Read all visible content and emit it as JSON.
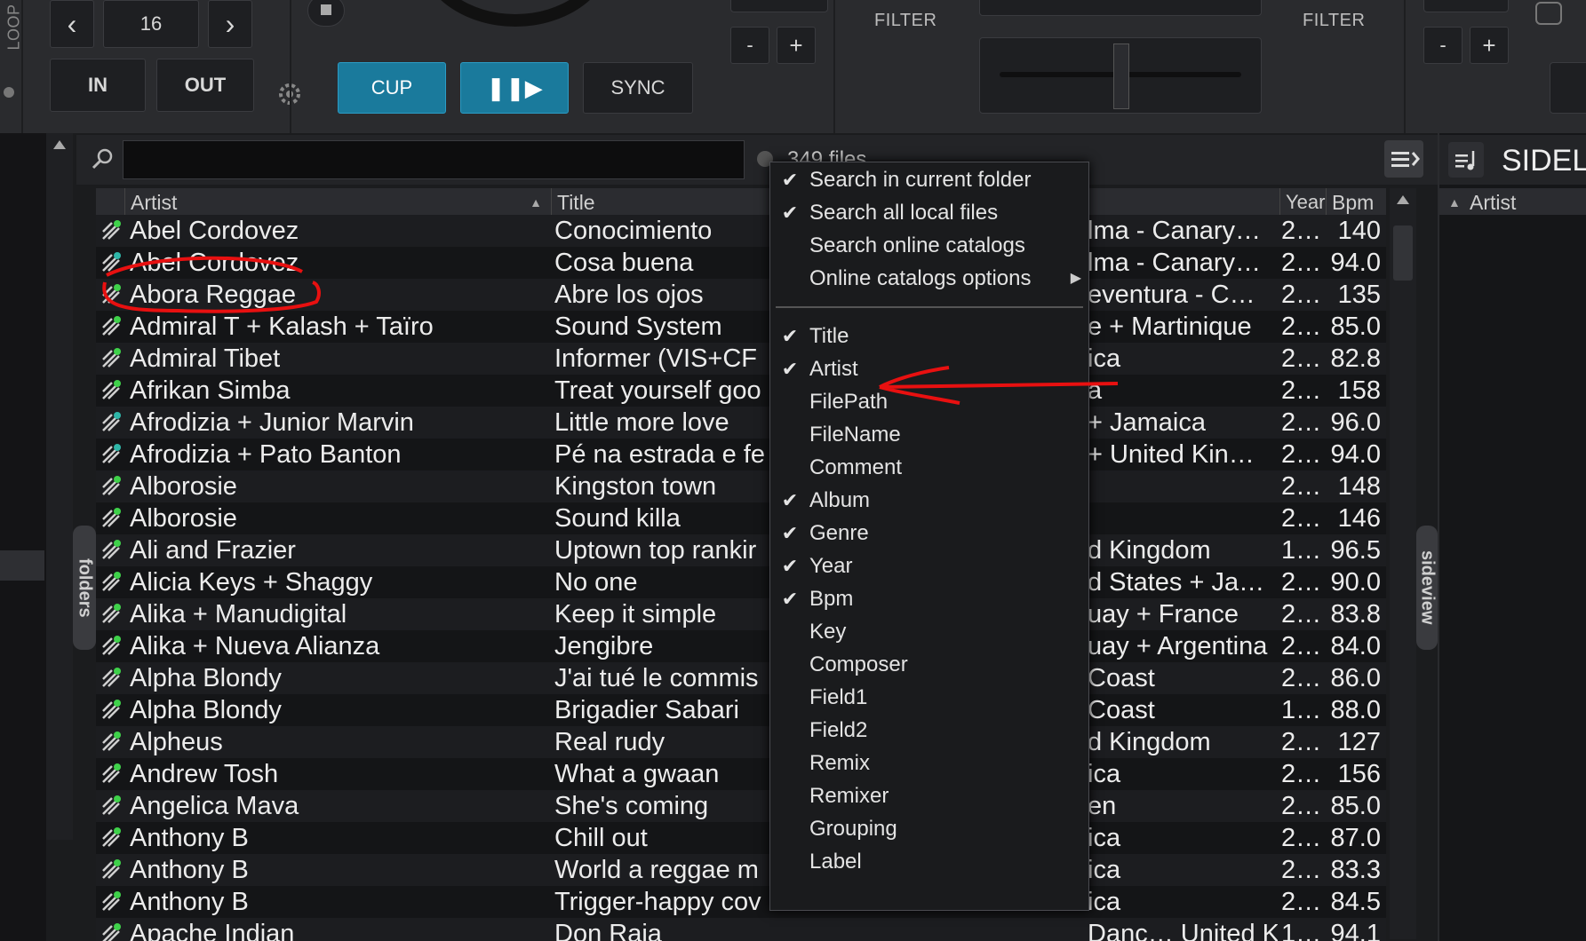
{
  "deck": {
    "loop_label": "LOOP",
    "loop_value": "16",
    "prev_label": "‹",
    "next_label": "›",
    "in_label": "IN",
    "out_label": "OUT",
    "cup_label": "CUP",
    "play_pause_label": "❚❚▶",
    "sync_label": "SYNC",
    "filter_left_label": "FILTER",
    "filter_right_label": "FILTER",
    "minus_label": "-",
    "plus_label": "+"
  },
  "browser": {
    "file_count": "349 files",
    "search_placeholder": "",
    "folders_tab": "folders",
    "sideview_tab": "sideview",
    "side_title": "SIDEL",
    "side_column": "Artist",
    "columns": [
      {
        "label": "Artist"
      },
      {
        "label": "Title"
      },
      {
        "label": "Year"
      },
      {
        "label": "Bpm"
      }
    ],
    "rows": [
      {
        "artist": "Abel Cordovez",
        "title": "Conocimiento",
        "extra": "lma - Canary…",
        "year": "2…",
        "bpm": "140",
        "icon": "green"
      },
      {
        "artist": "Abel Cordovez",
        "title": "Cosa buena",
        "extra": "lma - Canary…",
        "year": "2…",
        "bpm": "94.0",
        "icon": "teal"
      },
      {
        "artist": "Abora Reggae",
        "title": "Abre los ojos",
        "extra": "eventura - C…",
        "year": "2…",
        "bpm": "135",
        "icon": "green"
      },
      {
        "artist": "Admiral T + Kalash + Taïro",
        "title": "Sound System",
        "extra": "e + Martinique",
        "year": "2…",
        "bpm": "85.0",
        "icon": "green"
      },
      {
        "artist": "Admiral Tibet",
        "title": "Informer (VIS+CF",
        "extra": "ica",
        "year": "2…",
        "bpm": "82.8",
        "icon": "green"
      },
      {
        "artist": "Afrikan Simba",
        "title": "Treat yourself goo",
        "extra": "a",
        "year": "2…",
        "bpm": "158",
        "icon": "green"
      },
      {
        "artist": "Afrodizia + Junior Marvin",
        "title": "Little more love",
        "extra": "+ Jamaica",
        "year": "2…",
        "bpm": "96.0",
        "icon": "teal"
      },
      {
        "artist": "Afrodizia + Pato Banton",
        "title": "Pé na estrada e fe",
        "extra": "+ United Kin…",
        "year": "2…",
        "bpm": "94.0",
        "icon": "teal"
      },
      {
        "artist": "Alborosie",
        "title": "Kingston town",
        "extra": "",
        "year": "2…",
        "bpm": "148",
        "icon": "green"
      },
      {
        "artist": "Alborosie",
        "title": "Sound killa",
        "extra": "",
        "year": "2…",
        "bpm": "146",
        "icon": "green"
      },
      {
        "artist": "Ali and Frazier",
        "title": "Uptown top rankir",
        "extra": "d Kingdom",
        "year": "1…",
        "bpm": "96.5",
        "icon": "green"
      },
      {
        "artist": "Alicia Keys + Shaggy",
        "title": "No one",
        "extra": "d States + Ja…",
        "year": "2…",
        "bpm": "90.0",
        "icon": "green"
      },
      {
        "artist": "Alika + Manudigital",
        "title": "Keep it simple",
        "extra": "uay + France",
        "year": "2…",
        "bpm": "83.8",
        "icon": "green"
      },
      {
        "artist": "Alika + Nueva Alianza",
        "title": "Jengibre",
        "extra": "uay + Argentina",
        "year": "2…",
        "bpm": "84.0",
        "icon": "green"
      },
      {
        "artist": "Alpha Blondy",
        "title": "J'ai tué le commis",
        "extra": "Coast",
        "year": "2…",
        "bpm": "86.0",
        "icon": "green"
      },
      {
        "artist": "Alpha Blondy",
        "title": "Brigadier Sabari",
        "extra": "Coast",
        "year": "1…",
        "bpm": "88.0",
        "icon": "green"
      },
      {
        "artist": "Alpheus",
        "title": "Real rudy",
        "extra": "d Kingdom",
        "year": "2…",
        "bpm": "127",
        "icon": "green"
      },
      {
        "artist": "Andrew Tosh",
        "title": "What a gwaan",
        "extra": "ica",
        "year": "2…",
        "bpm": "156",
        "icon": "green"
      },
      {
        "artist": "Angelica Mava",
        "title": "She's coming",
        "extra": "en",
        "year": "2…",
        "bpm": "85.0",
        "icon": "green"
      },
      {
        "artist": "Anthony B",
        "title": "Chill out",
        "extra": "ica",
        "year": "2…",
        "bpm": "87.0",
        "icon": "green"
      },
      {
        "artist": "Anthony B",
        "title": "World a reggae m",
        "extra": "ica",
        "year": "2…",
        "bpm": "83.3",
        "icon": "green"
      },
      {
        "artist": "Anthony B",
        "title": "Trigger-happy cov",
        "extra": "ica",
        "year": "2…",
        "bpm": "84.5",
        "icon": "green"
      },
      {
        "artist": "Apache Indian",
        "title": "Don Raja",
        "extra": "Danc…  United Kingdom",
        "year": "1…",
        "bpm": "94.1",
        "icon": "green"
      }
    ]
  },
  "menu": {
    "items": [
      {
        "label": "Search in current folder",
        "checked": "✔"
      },
      {
        "label": "Search all local files",
        "checked": "✔"
      },
      {
        "label": "Search online catalogs",
        "checked": ""
      },
      {
        "label": "Online catalogs options",
        "checked": "",
        "arrow": "▶"
      },
      {
        "label": "Title",
        "checked": "✔"
      },
      {
        "label": "Artist",
        "checked": "✔"
      },
      {
        "label": "FilePath",
        "checked": ""
      },
      {
        "label": "FileName",
        "checked": ""
      },
      {
        "label": "Comment",
        "checked": ""
      },
      {
        "label": "Album",
        "checked": "✔"
      },
      {
        "label": "Genre",
        "checked": "✔"
      },
      {
        "label": "Year",
        "checked": "✔"
      },
      {
        "label": "Bpm",
        "checked": "✔"
      },
      {
        "label": "Key",
        "checked": ""
      },
      {
        "label": "Composer",
        "checked": ""
      },
      {
        "label": "Field1",
        "checked": ""
      },
      {
        "label": "Field2",
        "checked": ""
      },
      {
        "label": "Remix",
        "checked": ""
      },
      {
        "label": "Remixer",
        "checked": ""
      },
      {
        "label": "Grouping",
        "checked": ""
      },
      {
        "label": "Label",
        "checked": ""
      }
    ]
  },
  "colors": {
    "accent_blue": "#1a7a9c",
    "annotation_red": "#e81010",
    "icon_green": "#3fd14a",
    "icon_teal": "#2fb6a8"
  }
}
